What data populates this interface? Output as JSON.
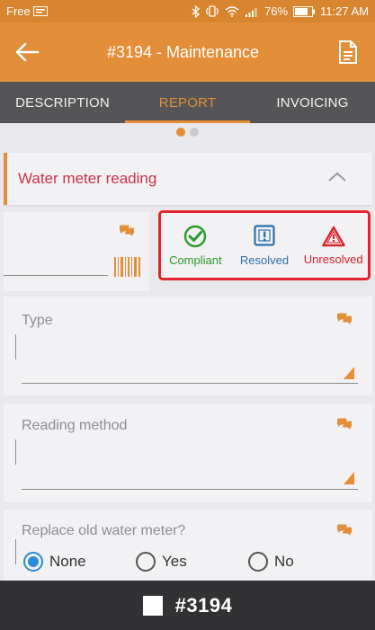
{
  "status_bar": {
    "carrier": "Free",
    "battery": "76%",
    "time": "11:27 AM"
  },
  "app_bar": {
    "title": "#3194 - Maintenance"
  },
  "tabs": [
    {
      "label": "DESCRIPTION",
      "active": false
    },
    {
      "label": "REPORT",
      "active": true
    },
    {
      "label": "INVOICING",
      "active": false
    }
  ],
  "section": {
    "title": "Water meter reading"
  },
  "status_options": [
    {
      "label": "Compliant",
      "icon": "check-circle-icon",
      "color": "#2c9a2c"
    },
    {
      "label": "Resolved",
      "icon": "exclamation-square-icon",
      "color": "#2f6fa8"
    },
    {
      "label": "Unresolved",
      "icon": "warning-triangle-icon",
      "color": "#d7232c"
    }
  ],
  "fields": {
    "type_label": "Type",
    "reading_method_label": "Reading method",
    "replace_label": "Replace old water meter?"
  },
  "radio_options": [
    {
      "label": "None",
      "selected": true
    },
    {
      "label": "Yes",
      "selected": false
    },
    {
      "label": "No",
      "selected": false
    }
  ],
  "bottom_bar": {
    "job_number": "#3194"
  },
  "colors": {
    "accent": "#e38e38",
    "tab_bar": "#555557",
    "highlight_box": "#e4232b",
    "section_title": "#c9334a",
    "radio_selected": "#2b8bd6"
  }
}
